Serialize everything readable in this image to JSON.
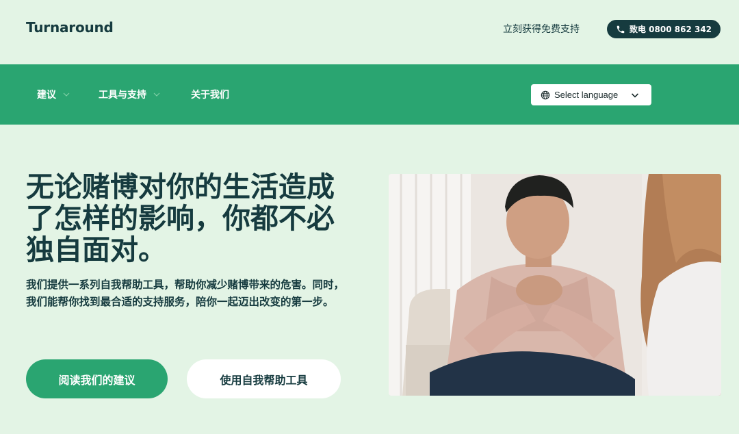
{
  "header": {
    "logo": "Turnaround",
    "support_link": "立刻获得免费支持",
    "call_button": "致电 0800 862 342",
    "phone_icon": "phone-icon"
  },
  "nav": {
    "items": [
      {
        "label": "建议",
        "has_dropdown": true
      },
      {
        "label": "工具与支持",
        "has_dropdown": true
      },
      {
        "label": "关于我们",
        "has_dropdown": false
      }
    ],
    "language": {
      "label": "Select language",
      "icon": "globe-icon",
      "chevron": "chevron-down-icon"
    }
  },
  "hero": {
    "headline": "无论赌博对你的生活造成了怎样的影响，你都不必独自面对。",
    "subtext": "我们提供一系列自我帮助工具，帮助你减少赌博带来的危害。同时，我们能帮你找到最合适的支持服务，陪你一起迈出改变的第一步。",
    "primary_button": "阅读我们的建议",
    "secondary_button": "使用自我帮助工具"
  },
  "colors": {
    "background": "#e3f4e5",
    "nav_green": "#2aa571",
    "dark_teal": "#163b3f",
    "white": "#ffffff"
  }
}
